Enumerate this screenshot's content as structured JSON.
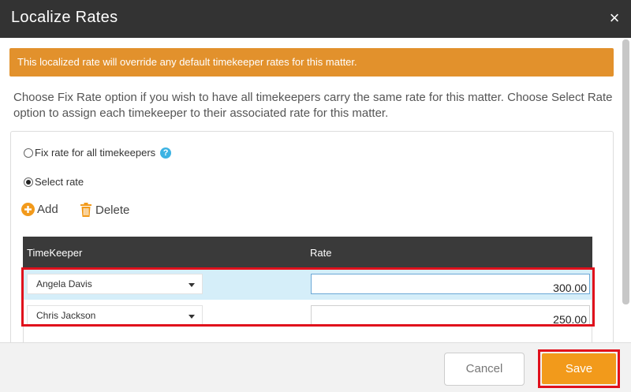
{
  "dialog": {
    "title": "Localize Rates",
    "close_icon": "close-icon",
    "close_glyph": "×"
  },
  "alert": {
    "text": "This localized rate will override any default timekeeper rates for this matter."
  },
  "description": "Choose Fix Rate option if you wish to have all timekeepers carry the same rate for this matter. Choose Select Rate option to assign each timekeeper to their associated rate for this matter.",
  "options": {
    "fix_rate_label": "Fix rate for all timekeepers",
    "fix_rate_selected": false,
    "help_glyph": "?",
    "select_rate_label": "Select rate",
    "select_rate_selected": true
  },
  "actions": {
    "add_label": "Add",
    "delete_label": "Delete"
  },
  "grid": {
    "columns": [
      "TimeKeeper",
      "Rate"
    ],
    "rows": [
      {
        "timekeeper": "Angela Davis",
        "rate": "300.00",
        "selected": true
      },
      {
        "timekeeper": "Chris Jackson",
        "rate": "250.00",
        "selected": false
      }
    ]
  },
  "footer": {
    "cancel_label": "Cancel",
    "save_label": "Save"
  },
  "colors": {
    "titlebar": "#333333",
    "alert": "#e2912c",
    "save": "#f29a1b",
    "highlight": "#e0101c",
    "selected_row": "#d5eef9",
    "icon_orange": "#f29a1b",
    "help": "#3db3e3"
  }
}
